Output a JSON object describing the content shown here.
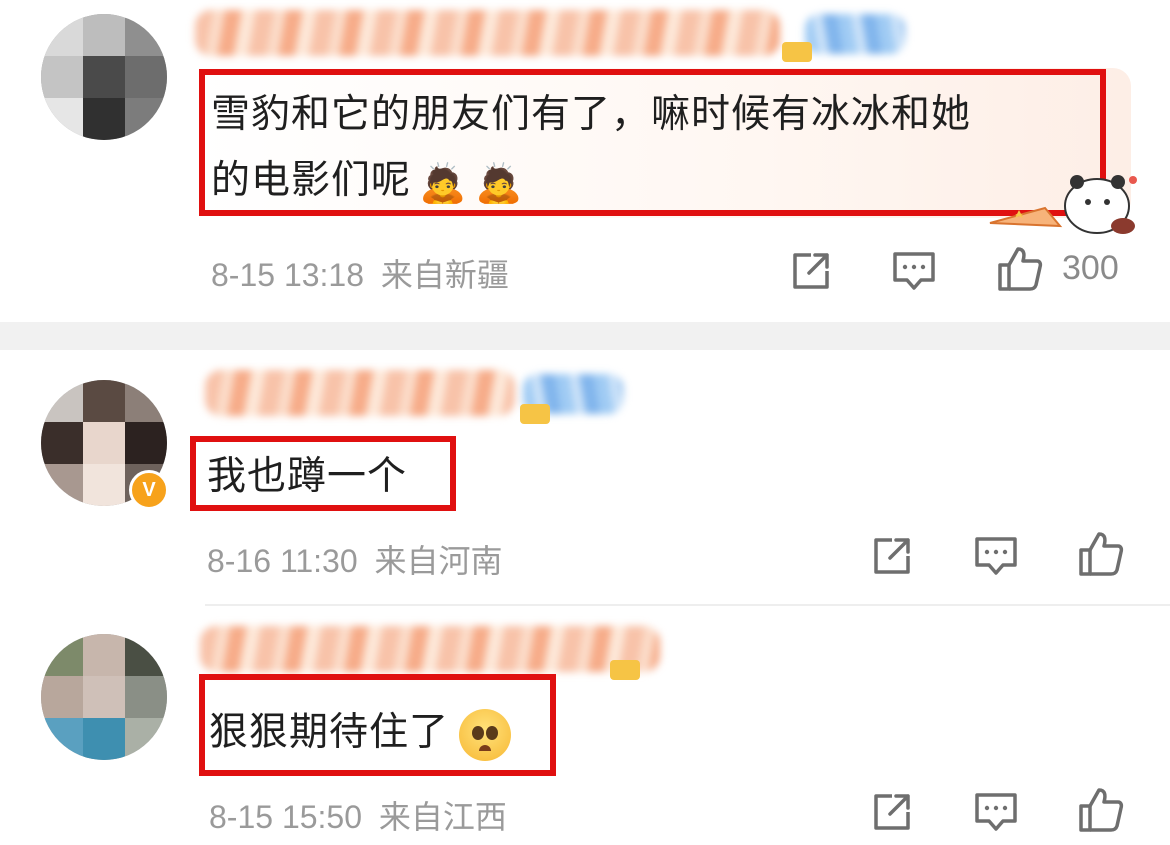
{
  "comments": [
    {
      "text_line1": "雪豹和它的朋友们有了，嘛时候有冰冰和她",
      "text_line2": "的电影们呢",
      "emojis": [
        "🙇",
        "🙇"
      ],
      "timestamp": "8-15 13:18",
      "location": "来自新疆",
      "like_count": "300"
    },
    {
      "text": "我也蹲一个",
      "timestamp": "8-16 11:30",
      "location": "来自河南",
      "verified_badge": "V"
    },
    {
      "text": "狠狠期待住了",
      "timestamp": "8-15 15:50",
      "location": "来自江西"
    }
  ],
  "icons": {
    "share": "share-icon",
    "comment": "comment-icon",
    "like": "like-icon"
  },
  "colors": {
    "highlight": "#e01010",
    "meta_text": "#9a9a9a",
    "verified_badge": "#f7a21b"
  }
}
